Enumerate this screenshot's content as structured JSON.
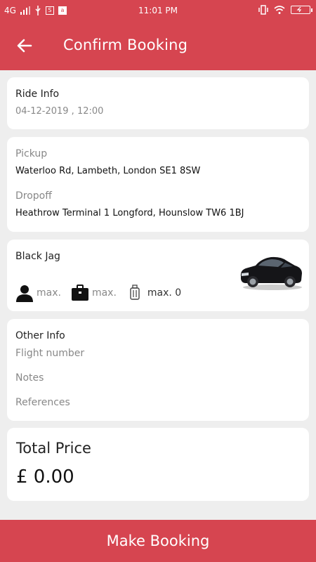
{
  "status_bar": {
    "network": "4G",
    "time": "11:01 PM"
  },
  "header": {
    "title": "Confirm Booking",
    "back_icon": "arrow-left-icon"
  },
  "ride_info": {
    "label": "Ride Info",
    "datetime": "04-12-2019 , 12:00"
  },
  "locations": {
    "pickup_label": "Pickup",
    "pickup_value": "Waterloo Rd, Lambeth, London SE1 8SW",
    "dropoff_label": "Dropoff",
    "dropoff_value": "Heathrow Terminal 1 Longford, Hounslow TW6 1BJ"
  },
  "vehicle": {
    "name": "Black Jag",
    "passengers_label": "max.",
    "luggage_label": "max.",
    "hand_luggage_label": "max. 0"
  },
  "other_info": {
    "title": "Other Info",
    "flight_number": "Flight number",
    "notes": "Notes",
    "references": "References"
  },
  "total": {
    "label": "Total Price",
    "value": "£ 0.00"
  },
  "footer": {
    "button_label": "Make Booking"
  },
  "colors": {
    "primary": "#d64550",
    "background": "#eeeeee"
  }
}
